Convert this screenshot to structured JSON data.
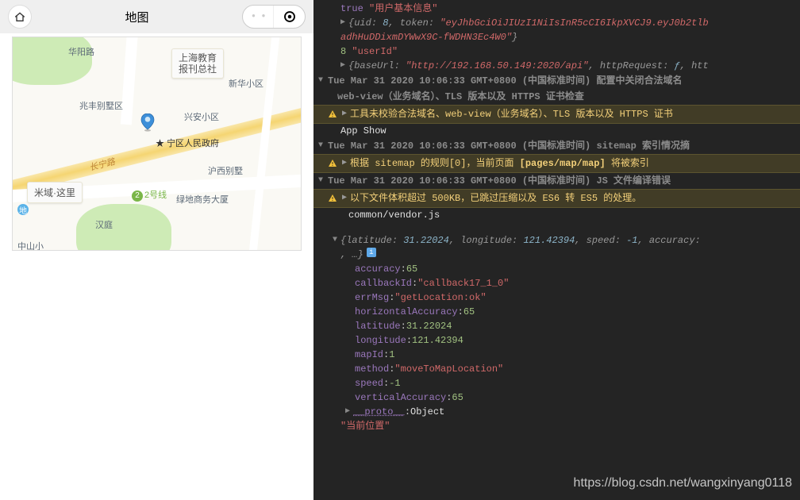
{
  "sim": {
    "title": "地图",
    "map_labels": {
      "label1": "上海教育\n报刊总社",
      "huayang": "华阳路",
      "zhaofeng": "兆丰别墅区",
      "xingan": "兴安小区",
      "xinhua": "新华小区",
      "government": "宁区人民政府",
      "changning_rd": "长宁路",
      "miyu": "米域·这里",
      "metro_num": "2号线",
      "hanting": "汉庭",
      "haixi": "沪西别墅",
      "shangwu": "绿地商务大厦",
      "zhongshan": "中山小"
    }
  },
  "console": {
    "line_true": "true",
    "line_true_str": "用户基本信息",
    "line_obj1": {
      "uid_key": "uid",
      "uid_val": "8",
      "token_key": "token",
      "token_val": "\"eyJhbGciOiJIUzI1NiIsInR5cCI6IkpXVCJ9.eyJ0b2tlb",
      "token_val2": "adhHuDDixmDYWwX9C-fWDHN3Ec4W0\""
    },
    "line_8": "8",
    "line_8_str": "userId",
    "line_baseurl_key": "baseUrl",
    "line_baseurl_val": "\"http://192.168.50.149:2020/api\"",
    "line_httpreq": "httpRequest",
    "line_f": "ƒ",
    "line_htt": "htt",
    "ts1": "Tue Mar 31 2020 10:06:33 GMT+0800 (中国标准时间) 配置中关闭合法域名",
    "ts1b": "web-view（业务域名）、TLS 版本以及 HTTPS 证书检查",
    "warn1": "工具未校验合法域名、web-view（业务域名）、TLS 版本以及 HTTPS 证书",
    "app_show": "App Show",
    "ts2": "Tue Mar 31 2020 10:06:33 GMT+0800 (中国标准时间) sitemap 索引情况摘",
    "warn2_a": "根据 sitemap 的规则[0]，当前页面 ",
    "warn2_b": "[pages/map/map]",
    "warn2_c": " 将被索引",
    "ts3": "Tue Mar 31 2020 10:06:33 GMT+0800 (中国标准时间) JS 文件编译错误",
    "warn3": "以下文件体积超过 500KB，已跳过压缩以及 ES6 转 ES5 的处理。",
    "file1": "common/vendor.js",
    "loc_head_a": "latitude",
    "loc_head_av": "31.22024",
    "loc_head_b": "longitude",
    "loc_head_bv": "121.42394",
    "loc_head_c": "speed",
    "loc_head_cv": "-1",
    "loc_head_d": "accuracy",
    "ellipsis": ", …}",
    "props": {
      "accuracy": "65",
      "callbackId": "\"callback17_1_0\"",
      "errMsg": "\"getLocation:ok\"",
      "horizontalAccuracy": "65",
      "latitude": "31.22024",
      "longitude": "121.42394",
      "mapId": "1",
      "method": "\"moveToMapLocation\"",
      "speed": "-1",
      "verticalAccuracy": "65",
      "__proto__": "Object"
    },
    "last_str": "当前位置"
  },
  "watermark": "https://blog.csdn.net/wangxinyang0118"
}
